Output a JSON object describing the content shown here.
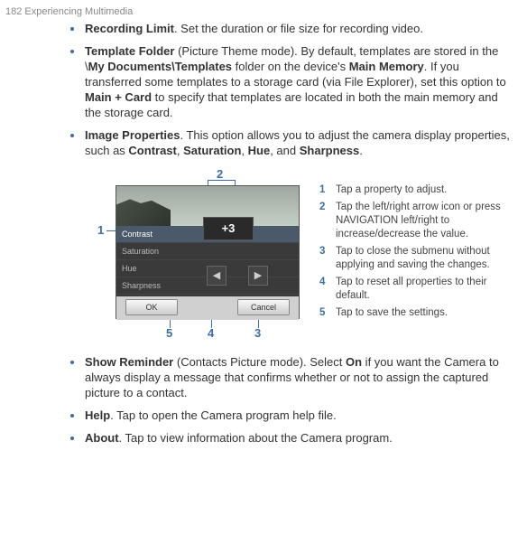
{
  "header": "182  Experiencing Multimedia",
  "items": {
    "recLimit": {
      "title": "Recording Limit",
      "text": ". Set the duration or file size for recording video."
    },
    "template": {
      "title": "Template Folder",
      "mode": " (Picture Theme mode). By default, templates are stored in the \\",
      "path1": "My Documents\\Templates",
      "mid1": " folder on the device's ",
      "path2": "Main Memory",
      "mid2": ". If you transferred some templates to a storage card (via File Explorer), set this option to ",
      "path3": "Main + Card",
      "end": " to specify that templates are located in both the main memory and the storage card."
    },
    "imgProps": {
      "title": "Image Properties",
      "text1": ". This option allows you to adjust the camera display properties, such as ",
      "p1": "Contrast",
      "c1": ", ",
      "p2": "Saturation",
      "c2": ", ",
      "p3": "Hue",
      "c3": ", and ",
      "p4": "Sharpness",
      "end": "."
    },
    "showRem": {
      "title": "Show Reminder",
      "mode": " (Contacts Picture mode). Select ",
      "on": "On",
      "text": " if you want the Camera to always display a message that confirms whether or not to assign the captured picture to a contact."
    },
    "help": {
      "title": "Help",
      "text": ". Tap to open the Camera program help file."
    },
    "about": {
      "title": "About",
      "text": ". Tap to view information about the Camera program."
    }
  },
  "figure": {
    "menu": {
      "r1": "Contrast",
      "r2": "Saturation",
      "r3": "Hue",
      "r4": "Sharpness"
    },
    "popup": "+3",
    "btn_ok": "OK",
    "btn_cancel": "Cancel",
    "callouts": {
      "n1": "1",
      "n2": "2",
      "n3": "3",
      "n4": "4",
      "n5": "5"
    }
  },
  "legend": {
    "l1": "Tap a property to adjust.",
    "l2": "Tap the left/right arrow icon or press NAVIGATION left/right to increase/decrease the value.",
    "l3": "Tap to close the submenu without applying and saving the changes.",
    "l4": "Tap to reset all properties to their default.",
    "l5": "Tap to save the settings."
  }
}
